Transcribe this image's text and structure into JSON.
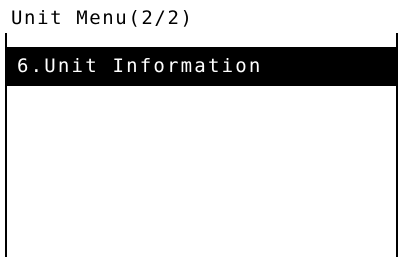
{
  "header": {
    "title": "Unit Menu(2/2)"
  },
  "menu": {
    "items": [
      {
        "label": "6.Unit Information",
        "selected": true
      }
    ]
  },
  "colors": {
    "background": "#ffffff",
    "foreground": "#000000",
    "selected_background": "#000000",
    "selected_text": "#ffffff"
  }
}
